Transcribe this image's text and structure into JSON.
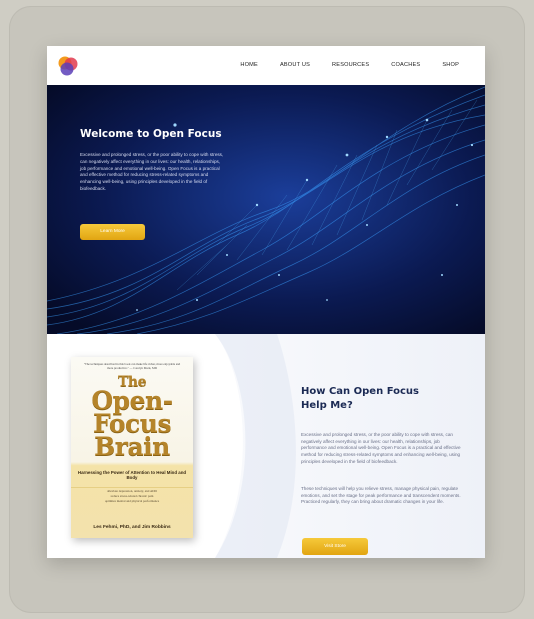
{
  "nav": {
    "items": [
      "HOME",
      "ABOUT US",
      "RESOURCES",
      "COACHES",
      "SHOP"
    ]
  },
  "hero": {
    "title": "Welcome to Open Focus",
    "text": "Excessive and prolonged stress, or the poor ability to cope with stress, can negatively affect everything in our lives: our health, relationships, job performance and emotional well-being. Open Focus is a practical and effective method for reducing stress-related symptoms and enhancing well-being, using principles developed in the field of biofeedback.",
    "button": "Learn More"
  },
  "book": {
    "quote": "\"The techniques described in this book can make life richer, more enjoyable and more productive.\" — Carolyn Mack, MD",
    "title_line1": "The",
    "title_line2": "Open-",
    "title_line3": "Focus",
    "title_line4": "Brain",
    "subtitle": "Harnessing the Power of Attention to Heal Mind and Body",
    "benefits": [
      "alleviate depression, anxiety, and ADD",
      "reduce stress-related chronic pain",
      "optimize mental and physical performance"
    ],
    "authors": "Les Fehmi, PhD, and Jim Robbins"
  },
  "help": {
    "title": "How Can Open Focus Help Me?",
    "paragraph1": "Excessive and prolonged stress, or the poor ability to cope with stress, can negatively affect everything in our lives: our health, relationships, job performance and emotional well-being. Open Focus is a practical and effective method for reducing stress-related symptoms and enhancing well-being, using principles developed in the field of biofeedback.",
    "paragraph2": "These techniques will help you relieve stress, manage physical pain, regulate emotions, and set the stage for peak performance and transcendent moments. Practiced regularly, they can bring about dramatic changes in your life.",
    "button": "Visit Store"
  },
  "colors": {
    "accent": "#f0b92a",
    "hero_bg": "#081237",
    "heading": "#1b2a54"
  },
  "icons": {
    "logo": "open-focus-logo"
  }
}
